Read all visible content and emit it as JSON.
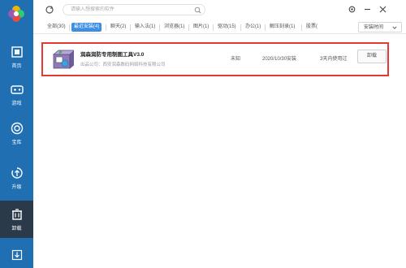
{
  "sidebar": {
    "items": [
      {
        "label": "首页",
        "icon": "home-icon"
      },
      {
        "label": "游戏",
        "icon": "gamepad-icon"
      },
      {
        "label": "宝库",
        "icon": "treasure-icon"
      },
      {
        "label": "升级",
        "icon": "upgrade-icon"
      },
      {
        "label": "卸载",
        "icon": "trash-icon"
      }
    ],
    "bottom_icon": "download-icon"
  },
  "search": {
    "placeholder": "请输入想搜索的软件"
  },
  "tabs": [
    {
      "label": "全部(30)"
    },
    {
      "label": "最近安装(4)"
    },
    {
      "label": "聊天(2)"
    },
    {
      "label": "输入法(1)"
    },
    {
      "label": "浏览器(1)"
    },
    {
      "label": "图片(1)"
    },
    {
      "label": "驱动(15)"
    },
    {
      "label": "办公(1)"
    },
    {
      "label": "解压刻录(1)"
    },
    {
      "label": "股票("
    }
  ],
  "sort": {
    "label": "安装时间"
  },
  "app": {
    "name": "润森润防专用制图工具V3.0",
    "publisher": "出品公司：西安润森数码网络科技有限公司",
    "size": "未知",
    "date": "2020/10/30安装",
    "usage": "3天内使用过",
    "uninstall_label": "卸载"
  },
  "colors": {
    "sidebar": "#1f6fb2",
    "active_nav": "#2b3a4a",
    "active_tab": "#3d8fe3",
    "highlight_border": "#e53935"
  }
}
